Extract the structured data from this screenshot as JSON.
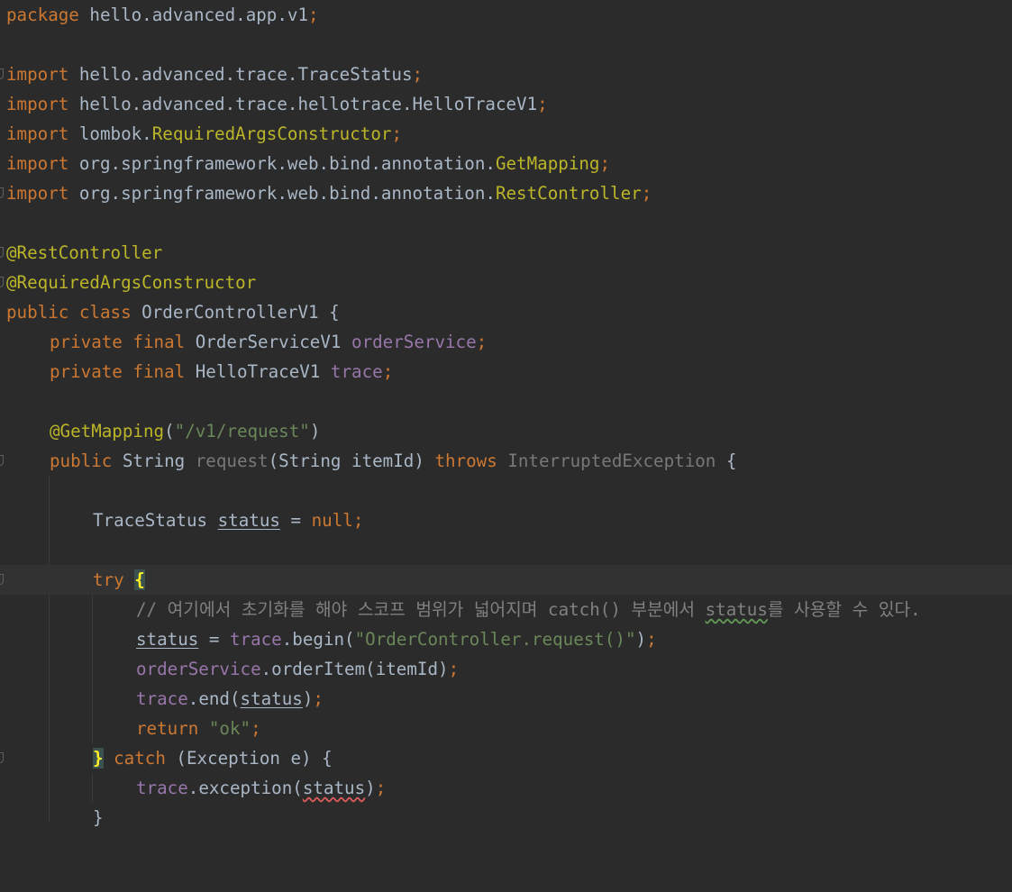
{
  "editor": {
    "theme": "darcula",
    "colors": {
      "background": "#2b2b2b",
      "current_line": "#323232",
      "keyword": "#cc7832",
      "annotation": "#bbb529",
      "string": "#6a8759",
      "field": "#9876aa",
      "text": "#a9b7c6",
      "comment": "#808080"
    },
    "lines": {
      "package_kw": "package",
      "package_name": " hello.advanced.app.v1",
      "semicolon": ";",
      "import_kw": "import",
      "imp1": " hello.advanced.trace.TraceStatus",
      "imp2": " hello.advanced.trace.hellotrace.HelloTraceV1",
      "imp3_pkg": " lombok.",
      "imp3_cls": "RequiredArgsConstructor",
      "imp4_pkg": " org.springframework.web.bind.annotation.",
      "imp4_cls": "GetMapping",
      "imp5_pkg": " org.springframework.web.bind.annotation.",
      "imp5_cls": "RestController",
      "ann_rest": "@RestController",
      "ann_req": "@RequiredArgsConstructor",
      "public_kw": "public",
      "class_kw": " class",
      "class_name": " OrderControllerV1 {",
      "private_kw": "private",
      "final_kw": " final",
      "field1_type": " OrderServiceV1 ",
      "field1_name": "orderService",
      "field2_type": " HelloTraceV1 ",
      "field2_name": "trace",
      "ann_get": "@GetMapping",
      "paren_open": "(",
      "get_path": "\"/v1/request\"",
      "paren_close": ")",
      "method_type": " String ",
      "method_name": "request",
      "method_params": "(String itemId) ",
      "throws_kw": "throws",
      "exception_name": " InterruptedException",
      "brace_open": " {",
      "status_type": "TraceStatus ",
      "status_var": "status",
      "assign": " = ",
      "null_kw": "null",
      "try_kw": "try",
      "brace": "{",
      "comment": "// 여기에서 초기화를 해야 스코프 범위가 넓어지며 catch() 부분에서 ",
      "comment_status": "status",
      "comment_tail": "를 사용할 수 있다.",
      "begin_call": ".begin(",
      "begin_arg": "\"OrderController.request()\"",
      "close_paren": ")",
      "order_call": ".orderItem(itemId)",
      "end_call": ".end(",
      "return_kw": "return",
      "ok_str": " \"ok\"",
      "close_brace": "}",
      "catch_kw": " catch",
      "catch_params": " (Exception e) {",
      "exception_call": ".exception(",
      "final_brace": "}"
    }
  }
}
